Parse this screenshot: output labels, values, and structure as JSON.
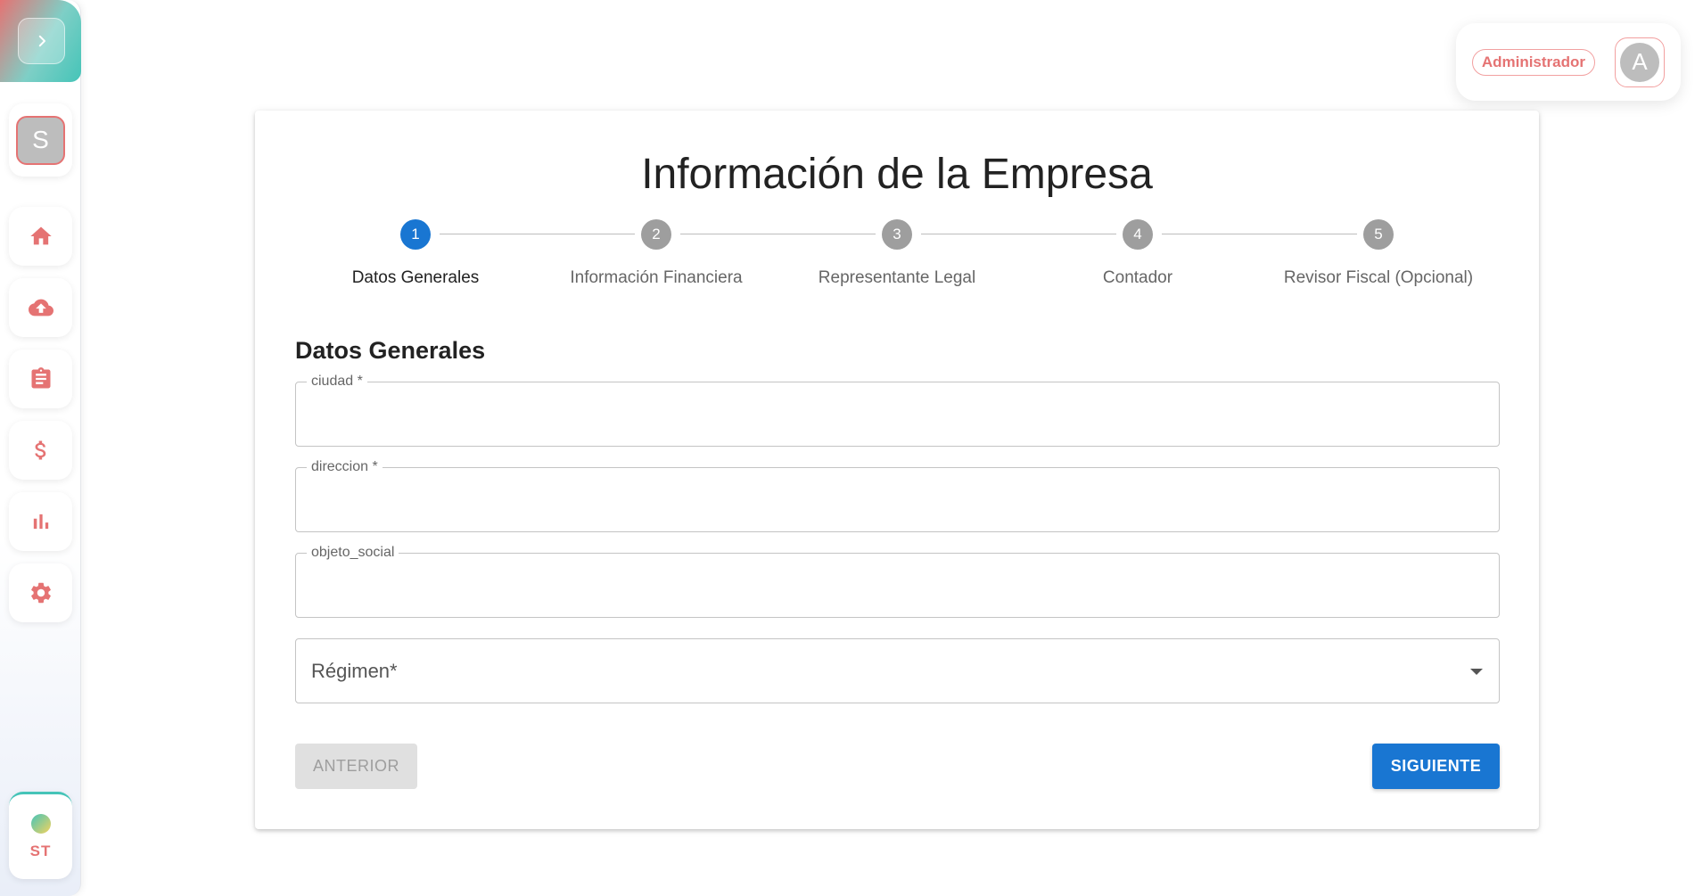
{
  "sidebar": {
    "user_initial": "S",
    "nav": [
      {
        "name": "home",
        "icon": "home-icon"
      },
      {
        "name": "upload",
        "icon": "cloud-upload-icon"
      },
      {
        "name": "tasks",
        "icon": "clipboard-icon"
      },
      {
        "name": "finance",
        "icon": "dollar-icon"
      },
      {
        "name": "reports",
        "icon": "bar-chart-icon"
      },
      {
        "name": "settings",
        "icon": "gear-icon"
      }
    ],
    "brand_text": "ST"
  },
  "header": {
    "role": "Administrador",
    "avatar_initial": "A"
  },
  "main": {
    "title": "Información de la Empresa",
    "steps": [
      {
        "number": "1",
        "label": "Datos Generales",
        "active": true
      },
      {
        "number": "2",
        "label": "Información Financiera",
        "active": false
      },
      {
        "number": "3",
        "label": "Representante Legal",
        "active": false
      },
      {
        "number": "4",
        "label": "Contador",
        "active": false
      },
      {
        "number": "5",
        "label": "Revisor Fiscal (Opcional)",
        "active": false
      }
    ],
    "section_title": "Datos Generales",
    "fields": {
      "ciudad": {
        "label": "ciudad *",
        "value": ""
      },
      "direccion": {
        "label": "direccion *",
        "value": ""
      },
      "objeto_social": {
        "label": "objeto_social",
        "value": ""
      }
    },
    "regimen": {
      "label": "Régimen*"
    },
    "buttons": {
      "prev": "ANTERIOR",
      "next": "SIGUIENTE"
    }
  },
  "colors": {
    "accent": "#e57373",
    "primary": "#1976d2",
    "teal": "#45c4b8"
  }
}
